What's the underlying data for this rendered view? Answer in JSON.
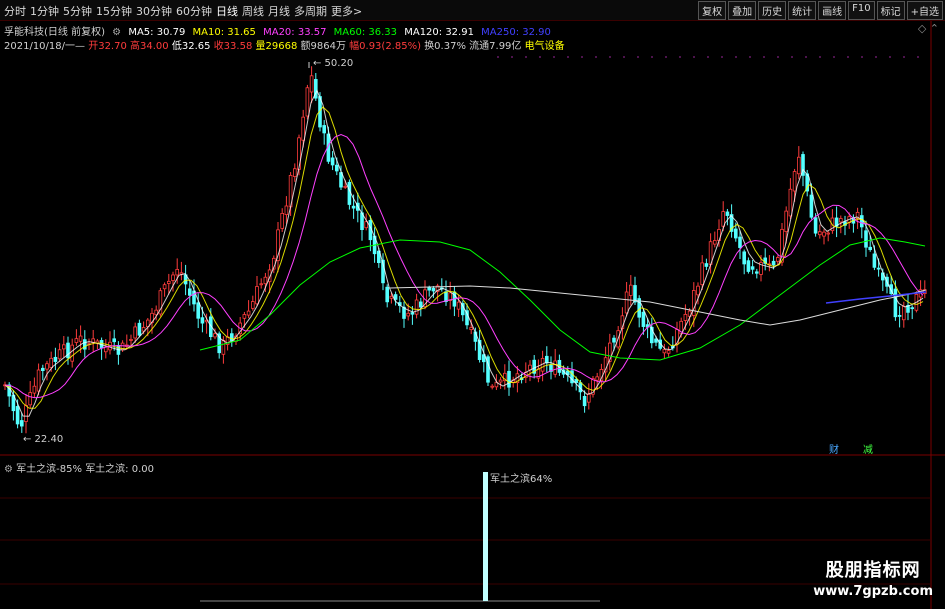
{
  "toolbar": {
    "periods": [
      "分时",
      "1分钟",
      "5分钟",
      "15分钟",
      "30分钟",
      "60分钟",
      "日线",
      "周线",
      "月线",
      "多周期",
      "更多>"
    ],
    "actions": [
      "复权",
      "叠加",
      "历史",
      "统计",
      "画线",
      "F10",
      "标记",
      "+自选"
    ]
  },
  "stock": {
    "title": "孚能科技(日线 前复权)",
    "ma5": "MA5: 30.79",
    "ma10": "MA10: 31.65",
    "ma20": "MA20: 33.57",
    "ma60": "MA60: 36.33",
    "ma120": "MA120: 32.91",
    "ma250": "MA250: 32.90"
  },
  "quote": {
    "date": "2021/10/18/一",
    "open": "开32.70",
    "high": "高34.00",
    "low": "低32.65",
    "close": "收33.58",
    "volume": "量29668",
    "amount": "额9864万",
    "change": "幅0.93(2.85%)",
    "turnover": "换0.37%",
    "float": "流通7.99亿",
    "sector": "电气设备"
  },
  "price_labels": {
    "high": "50.20",
    "low": "22.40"
  },
  "markers": [
    "财",
    "减"
  ],
  "indicator": {
    "name": "军土之滨",
    "value": "-85%",
    "name2": "军土之滨:",
    "value2": "0.00",
    "bar_label": "军土之滨64%"
  },
  "watermark": {
    "line1": "股朋指标网",
    "line2": "www.7gpzb.com"
  },
  "colors": {
    "up": "#ff3c3c",
    "down": "#54ffff",
    "ma5": "#ffffff",
    "ma10": "#ffff00",
    "ma20": "#ff40ff",
    "ma60": "#00ff00",
    "ma120": "#ffffff",
    "ma250": "#4040ff"
  }
}
